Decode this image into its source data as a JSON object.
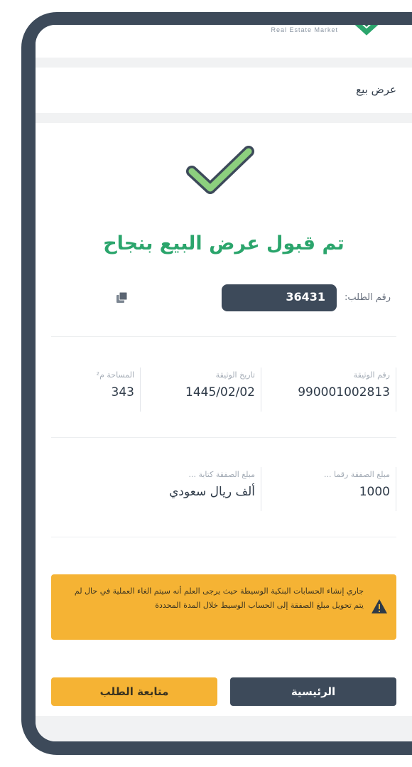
{
  "brand": {
    "name": "Real Estate Market",
    "logo_icon": "brand-logo-icon"
  },
  "header": {
    "title": "عرض بيع"
  },
  "success": {
    "icon": "check-icon",
    "title": "تم قبول عرض البيع بنجاح"
  },
  "request": {
    "label": "رقم الطلب:",
    "number": "36431",
    "copy_icon": "copy-icon"
  },
  "deed": {
    "number_label": "رقم الوثيقة",
    "number_value": "990001002813",
    "date_label": "تاريخ الوثيقة",
    "date_value": "1445/02/02",
    "area_label": "المساحة م²",
    "area_value": "343"
  },
  "amounts": {
    "numeric_label": "مبلغ الصفقة رقما ...",
    "numeric_value": "1000",
    "text_label": "مبلغ الصفقة كتابة ...",
    "text_value": "ألف ريال سعودي"
  },
  "warning": {
    "icon": "warning-icon",
    "text": "جاري إنشاء الحسابات البنكية الوسيطة حيث يرجى العلم أنه سيتم الغاء العملية في حال لم يتم تحويل مبلغ الصفقة إلى الحساب الوسيط خلال المدة المحددة"
  },
  "actions": {
    "home_label": "الرئيسية",
    "follow_label": "متابعة الطلب"
  },
  "colors": {
    "frame": "#3d4a5a",
    "success": "#2ba56c",
    "warning": "#f5b334",
    "check_fill": "#8ccf7e"
  }
}
